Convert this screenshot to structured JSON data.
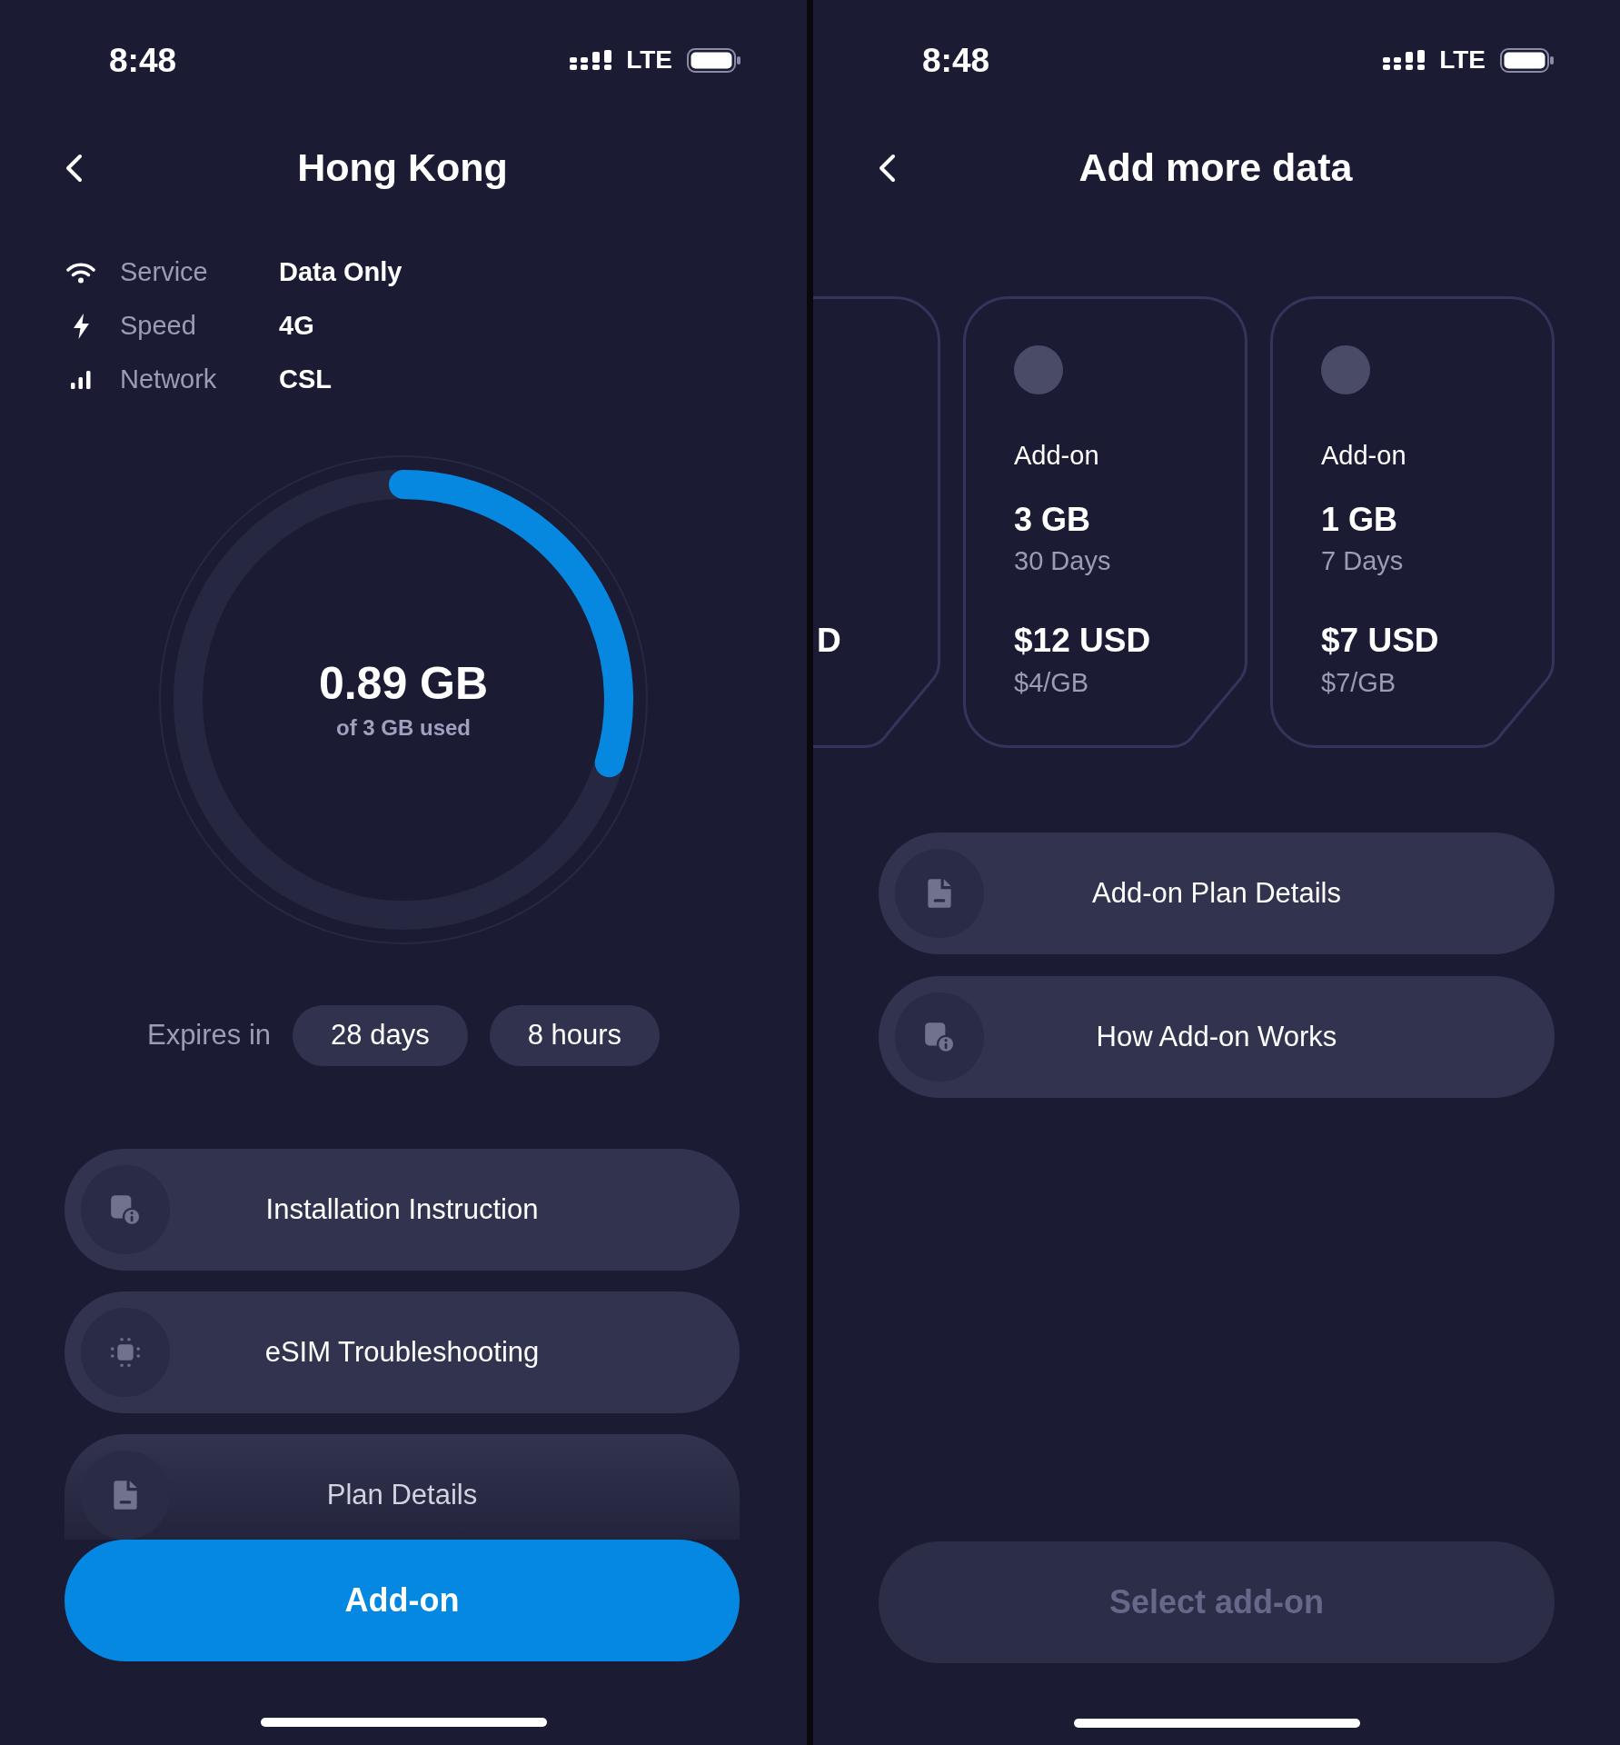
{
  "plan_screen": {
    "status_bar": {
      "time": "8:48",
      "network": "LTE"
    },
    "title": "Hong Kong",
    "info": [
      {
        "kind": "service",
        "label": "Service",
        "value": "Data Only"
      },
      {
        "kind": "speed",
        "label": "Speed",
        "value": "4G"
      },
      {
        "kind": "network",
        "label": "Network",
        "value": "CSL"
      }
    ],
    "usage": {
      "amount": "0.89 GB",
      "caption": "of 3 GB used",
      "level": 0.297
    },
    "expiry": {
      "label": "Expires in",
      "chips": [
        "28 days",
        "8 hours"
      ]
    },
    "menu": [
      {
        "kind": "guide",
        "label": "Installation Instruction"
      },
      {
        "kind": "troubleshooting",
        "label": "eSIM Troubleshooting"
      },
      {
        "kind": "details",
        "label": "Plan Details"
      }
    ],
    "primary_button": {
      "label": "Add-on",
      "disabled": false
    }
  },
  "addon_screen": {
    "status_bar": {
      "time": "8:48",
      "network": "LTE"
    },
    "title": "Add more data",
    "partial_card": {
      "price": "D"
    },
    "cards": [
      {
        "selected": false,
        "label": "Add-on",
        "data": "3 GB",
        "validity": "30 Days",
        "price": "$12 USD",
        "unit_price": "$4/GB"
      },
      {
        "selected": false,
        "label": "Add-on",
        "data": "1 GB",
        "validity": "7 Days",
        "price": "$7 USD",
        "unit_price": "$7/GB"
      }
    ],
    "menu": [
      {
        "kind": "details",
        "label": "Add-on Plan Details"
      },
      {
        "kind": "guide",
        "label": "How Add-on Works"
      }
    ],
    "primary_button": {
      "label": "Select add-on",
      "disabled": true
    }
  }
}
